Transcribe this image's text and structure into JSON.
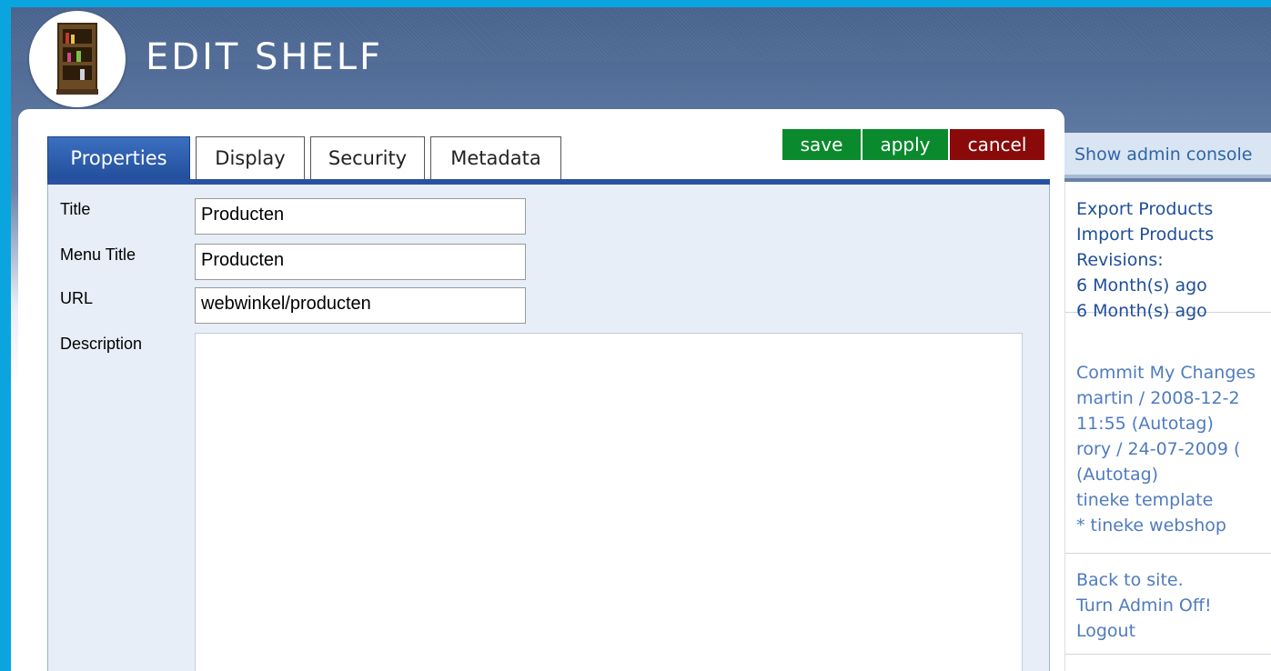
{
  "header": {
    "title": "EDIT SHELF",
    "logo_icon": "bookshelf-icon"
  },
  "tabs": [
    {
      "label": "Properties",
      "active": true
    },
    {
      "label": "Display",
      "active": false
    },
    {
      "label": "Security",
      "active": false
    },
    {
      "label": "Metadata",
      "active": false
    }
  ],
  "actions": {
    "save": "save",
    "apply": "apply",
    "cancel": "cancel"
  },
  "form": {
    "title_label": "Title",
    "title_value": "Producten",
    "menu_title_label": "Menu Title",
    "menu_title_value": "Producten",
    "url_label": "URL",
    "url_value": "webwinkel/producten",
    "description_label": "Description",
    "description_value": ""
  },
  "sidebar": {
    "header": "Show admin console",
    "section1": {
      "export": "Export Products",
      "import": "Import Products",
      "revisions_label": "Revisions:",
      "revisions": [
        "6 Month(s) ago",
        "6 Month(s) ago"
      ]
    },
    "section2": {
      "lines": [
        "Commit My Changes",
        "martin / 2008-12-2",
        "11:55 (Autotag)",
        "rory / 24-07-2009 (",
        "(Autotag)",
        "tineke template",
        "* tineke webshop"
      ]
    },
    "section3": {
      "back": "Back to site.",
      "turn_off": "Turn Admin Off!",
      "logout": "Logout"
    }
  },
  "colors": {
    "tab_active": "#2652a1",
    "save_apply": "#0b8a2d",
    "cancel": "#8a0a0a",
    "sidebar_link": "#1f4f9a",
    "sidebar_muted": "#4f7bbf"
  }
}
